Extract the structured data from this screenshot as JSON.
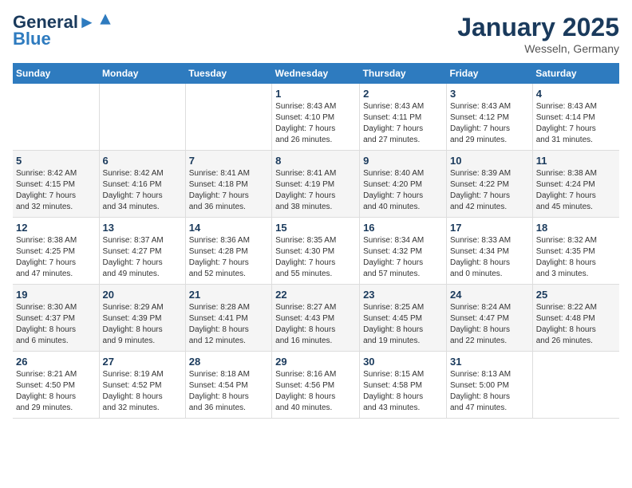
{
  "header": {
    "logo_line1": "General",
    "logo_line2": "Blue",
    "month_title": "January 2025",
    "location": "Wesseln, Germany"
  },
  "weekdays": [
    "Sunday",
    "Monday",
    "Tuesday",
    "Wednesday",
    "Thursday",
    "Friday",
    "Saturday"
  ],
  "weeks": [
    [
      {
        "day": "",
        "info": ""
      },
      {
        "day": "",
        "info": ""
      },
      {
        "day": "",
        "info": ""
      },
      {
        "day": "1",
        "info": "Sunrise: 8:43 AM\nSunset: 4:10 PM\nDaylight: 7 hours\nand 26 minutes."
      },
      {
        "day": "2",
        "info": "Sunrise: 8:43 AM\nSunset: 4:11 PM\nDaylight: 7 hours\nand 27 minutes."
      },
      {
        "day": "3",
        "info": "Sunrise: 8:43 AM\nSunset: 4:12 PM\nDaylight: 7 hours\nand 29 minutes."
      },
      {
        "day": "4",
        "info": "Sunrise: 8:43 AM\nSunset: 4:14 PM\nDaylight: 7 hours\nand 31 minutes."
      }
    ],
    [
      {
        "day": "5",
        "info": "Sunrise: 8:42 AM\nSunset: 4:15 PM\nDaylight: 7 hours\nand 32 minutes."
      },
      {
        "day": "6",
        "info": "Sunrise: 8:42 AM\nSunset: 4:16 PM\nDaylight: 7 hours\nand 34 minutes."
      },
      {
        "day": "7",
        "info": "Sunrise: 8:41 AM\nSunset: 4:18 PM\nDaylight: 7 hours\nand 36 minutes."
      },
      {
        "day": "8",
        "info": "Sunrise: 8:41 AM\nSunset: 4:19 PM\nDaylight: 7 hours\nand 38 minutes."
      },
      {
        "day": "9",
        "info": "Sunrise: 8:40 AM\nSunset: 4:20 PM\nDaylight: 7 hours\nand 40 minutes."
      },
      {
        "day": "10",
        "info": "Sunrise: 8:39 AM\nSunset: 4:22 PM\nDaylight: 7 hours\nand 42 minutes."
      },
      {
        "day": "11",
        "info": "Sunrise: 8:38 AM\nSunset: 4:24 PM\nDaylight: 7 hours\nand 45 minutes."
      }
    ],
    [
      {
        "day": "12",
        "info": "Sunrise: 8:38 AM\nSunset: 4:25 PM\nDaylight: 7 hours\nand 47 minutes."
      },
      {
        "day": "13",
        "info": "Sunrise: 8:37 AM\nSunset: 4:27 PM\nDaylight: 7 hours\nand 49 minutes."
      },
      {
        "day": "14",
        "info": "Sunrise: 8:36 AM\nSunset: 4:28 PM\nDaylight: 7 hours\nand 52 minutes."
      },
      {
        "day": "15",
        "info": "Sunrise: 8:35 AM\nSunset: 4:30 PM\nDaylight: 7 hours\nand 55 minutes."
      },
      {
        "day": "16",
        "info": "Sunrise: 8:34 AM\nSunset: 4:32 PM\nDaylight: 7 hours\nand 57 minutes."
      },
      {
        "day": "17",
        "info": "Sunrise: 8:33 AM\nSunset: 4:34 PM\nDaylight: 8 hours\nand 0 minutes."
      },
      {
        "day": "18",
        "info": "Sunrise: 8:32 AM\nSunset: 4:35 PM\nDaylight: 8 hours\nand 3 minutes."
      }
    ],
    [
      {
        "day": "19",
        "info": "Sunrise: 8:30 AM\nSunset: 4:37 PM\nDaylight: 8 hours\nand 6 minutes."
      },
      {
        "day": "20",
        "info": "Sunrise: 8:29 AM\nSunset: 4:39 PM\nDaylight: 8 hours\nand 9 minutes."
      },
      {
        "day": "21",
        "info": "Sunrise: 8:28 AM\nSunset: 4:41 PM\nDaylight: 8 hours\nand 12 minutes."
      },
      {
        "day": "22",
        "info": "Sunrise: 8:27 AM\nSunset: 4:43 PM\nDaylight: 8 hours\nand 16 minutes."
      },
      {
        "day": "23",
        "info": "Sunrise: 8:25 AM\nSunset: 4:45 PM\nDaylight: 8 hours\nand 19 minutes."
      },
      {
        "day": "24",
        "info": "Sunrise: 8:24 AM\nSunset: 4:47 PM\nDaylight: 8 hours\nand 22 minutes."
      },
      {
        "day": "25",
        "info": "Sunrise: 8:22 AM\nSunset: 4:48 PM\nDaylight: 8 hours\nand 26 minutes."
      }
    ],
    [
      {
        "day": "26",
        "info": "Sunrise: 8:21 AM\nSunset: 4:50 PM\nDaylight: 8 hours\nand 29 minutes."
      },
      {
        "day": "27",
        "info": "Sunrise: 8:19 AM\nSunset: 4:52 PM\nDaylight: 8 hours\nand 32 minutes."
      },
      {
        "day": "28",
        "info": "Sunrise: 8:18 AM\nSunset: 4:54 PM\nDaylight: 8 hours\nand 36 minutes."
      },
      {
        "day": "29",
        "info": "Sunrise: 8:16 AM\nSunset: 4:56 PM\nDaylight: 8 hours\nand 40 minutes."
      },
      {
        "day": "30",
        "info": "Sunrise: 8:15 AM\nSunset: 4:58 PM\nDaylight: 8 hours\nand 43 minutes."
      },
      {
        "day": "31",
        "info": "Sunrise: 8:13 AM\nSunset: 5:00 PM\nDaylight: 8 hours\nand 47 minutes."
      },
      {
        "day": "",
        "info": ""
      }
    ]
  ]
}
